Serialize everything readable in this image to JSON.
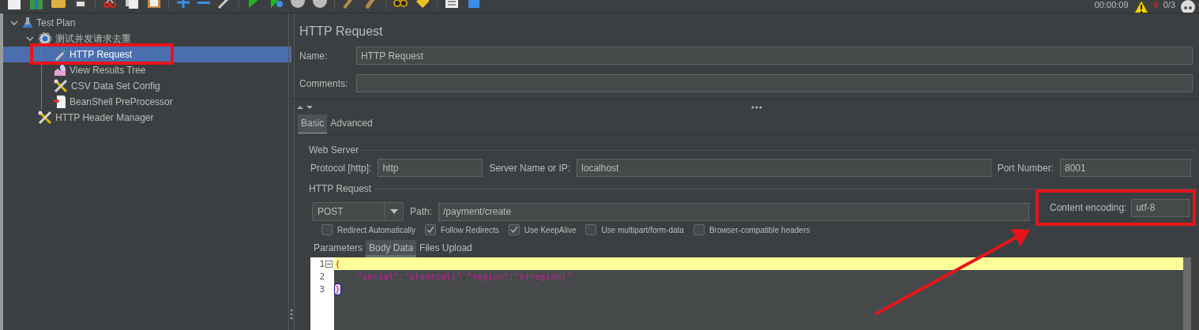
{
  "toolbar": {
    "elapsed": "00:00:09",
    "warnings": "9",
    "threads": "0/3"
  },
  "tree": [
    {
      "label": "Test Plan",
      "kind": "flask",
      "expanded": true,
      "selected": false,
      "children": [
        {
          "label": "测试并发请求去重",
          "kind": "gear",
          "expanded": true,
          "selected": false,
          "children": [
            {
              "label": "HTTP Request",
              "kind": "pipette",
              "selected": true
            },
            {
              "label": "View Results Tree",
              "kind": "chart",
              "selected": false
            },
            {
              "label": "CSV Data Set Config",
              "kind": "tools",
              "selected": false
            },
            {
              "label": "BeanShell PreProcessor",
              "kind": "script",
              "selected": false
            }
          ]
        },
        {
          "label": "HTTP Header Manager",
          "kind": "tools",
          "selected": false
        }
      ]
    }
  ],
  "panel": {
    "title": "HTTP Request",
    "name": {
      "label": "Name:",
      "value": "HTTP Request"
    },
    "comments": {
      "label": "Comments:"
    },
    "tabs": [
      {
        "label": "Basic",
        "selected": true
      },
      {
        "label": "Advanced",
        "selected": false
      }
    ],
    "web_server": {
      "legend": "Web Server",
      "protocol": {
        "label": "Protocol [http]:",
        "value": "http"
      },
      "server": {
        "label": "Server Name or IP:",
        "value": "localhost"
      },
      "port": {
        "label": "Port Number:",
        "value": "8001"
      }
    },
    "http_request": {
      "legend": "HTTP Request",
      "method": "POST",
      "path": {
        "label": "Path:",
        "value": "/payment/create"
      },
      "encoding": {
        "label": "Content encoding:",
        "value": "utf-8"
      }
    },
    "options": [
      {
        "label": "Redirect Automatically",
        "checked": false
      },
      {
        "label": "Follow Redirects",
        "checked": true
      },
      {
        "label": "Use KeepAlive",
        "checked": true
      },
      {
        "label": "Use multipart/form-data",
        "checked": false
      },
      {
        "label": "Browser-compatible headers",
        "checked": false
      }
    ],
    "body_tabs": [
      {
        "label": "Parameters",
        "selected": false
      },
      {
        "label": "Body Data",
        "selected": true
      },
      {
        "label": "Files Upload",
        "selected": false
      }
    ],
    "body_lines": [
      {
        "number": "1",
        "current": true,
        "segments": [
          {
            "text": "{",
            "kind": "brace"
          }
        ]
      },
      {
        "number": "2",
        "current": false,
        "segments": [
          {
            "text": "\"serial\":\"${serial}\"",
            "kind": "string"
          },
          {
            "text": ",",
            "kind": "punct"
          },
          {
            "text": "\"region\":\"${region}\"",
            "kind": "string"
          }
        ]
      },
      {
        "number": "3",
        "current": false,
        "segments": [
          {
            "text": "}",
            "kind": "match"
          }
        ]
      }
    ]
  }
}
